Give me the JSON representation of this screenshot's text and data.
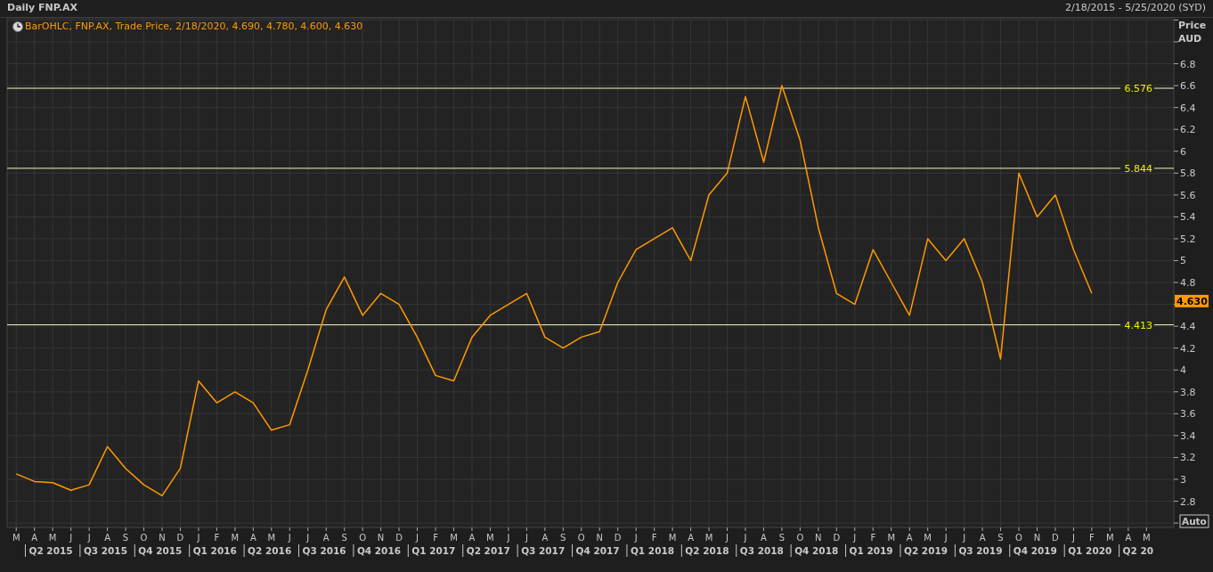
{
  "header": {
    "title": "Daily FNP.AX",
    "date_range": "2/18/2015 - 5/25/2020 (SYD)"
  },
  "legend": "BarOHLC, FNP.AX, Trade Price, 2/18/2020, 4.690, 4.780, 4.600, 4.630",
  "axis": {
    "title": "Price",
    "unit": "AUD",
    "auto_button": "Auto"
  },
  "last_price": {
    "label": "4.630"
  },
  "quarters": [
    "Q2 2015",
    "Q3 2015",
    "Q4 2015",
    "Q1 2016",
    "Q2 2016",
    "Q3 2016",
    "Q4 2016",
    "Q1 2017",
    "Q2 2017",
    "Q3 2017",
    "Q4 2017",
    "Q1 2018",
    "Q2 2018",
    "Q3 2018",
    "Q4 2018",
    "Q1 2019",
    "Q2 2019",
    "Q3 2019",
    "Q4 2019",
    "Q1 2020",
    "Q2 20"
  ],
  "chart_data": {
    "type": "line",
    "ylim": [
      2.56,
      7.22
    ],
    "grid": true,
    "ref_lines": [
      {
        "axis": "y",
        "value": 6.576,
        "label": "6.576"
      },
      {
        "axis": "y",
        "value": 5.844,
        "label": "5.844"
      },
      {
        "axis": "y",
        "value": 4.413,
        "label": "4.413"
      }
    ],
    "yticks": [
      2.8,
      3,
      3.2,
      3.4,
      3.6,
      3.8,
      4,
      4.2,
      4.4,
      4.8,
      5,
      5.2,
      5.4,
      5.6,
      5.8,
      6,
      6.2,
      6.4,
      6.6,
      6.8
    ],
    "categories": [
      "M",
      "A",
      "M",
      "J",
      "J",
      "A",
      "S",
      "O",
      "N",
      "D",
      "J",
      "F",
      "M",
      "A",
      "M",
      "J",
      "J",
      "A",
      "S",
      "O",
      "N",
      "D",
      "J",
      "F",
      "M",
      "A",
      "M",
      "J",
      "J",
      "A",
      "S",
      "O",
      "N",
      "D",
      "J",
      "F",
      "M",
      "A",
      "M",
      "J",
      "J",
      "A",
      "S",
      "O",
      "N",
      "D",
      "J",
      "F",
      "M",
      "A",
      "M",
      "J",
      "J",
      "A",
      "S",
      "O",
      "N",
      "D",
      "J",
      "F",
      "M",
      "A",
      "M"
    ],
    "series": [
      {
        "color": "#ff9900",
        "values": [
          3.05,
          2.98,
          2.97,
          2.9,
          2.95,
          3.3,
          3.1,
          2.95,
          2.85,
          3.1,
          3.9,
          3.7,
          3.8,
          3.7,
          3.45,
          3.5,
          4.0,
          4.55,
          4.85,
          4.5,
          4.7,
          4.6,
          4.3,
          3.95,
          3.9,
          4.3,
          4.5,
          4.6,
          4.7,
          4.3,
          4.2,
          4.3,
          4.35,
          4.8,
          5.1,
          5.2,
          5.3,
          5.0,
          5.6,
          5.8,
          6.5,
          5.9,
          6.6,
          6.1,
          5.3,
          4.7,
          4.6,
          5.1,
          4.8,
          4.5,
          5.2,
          5.0,
          5.2,
          4.8,
          4.1,
          5.8,
          5.4,
          5.6,
          5.1,
          4.7,
          null,
          null,
          null
        ]
      }
    ]
  }
}
